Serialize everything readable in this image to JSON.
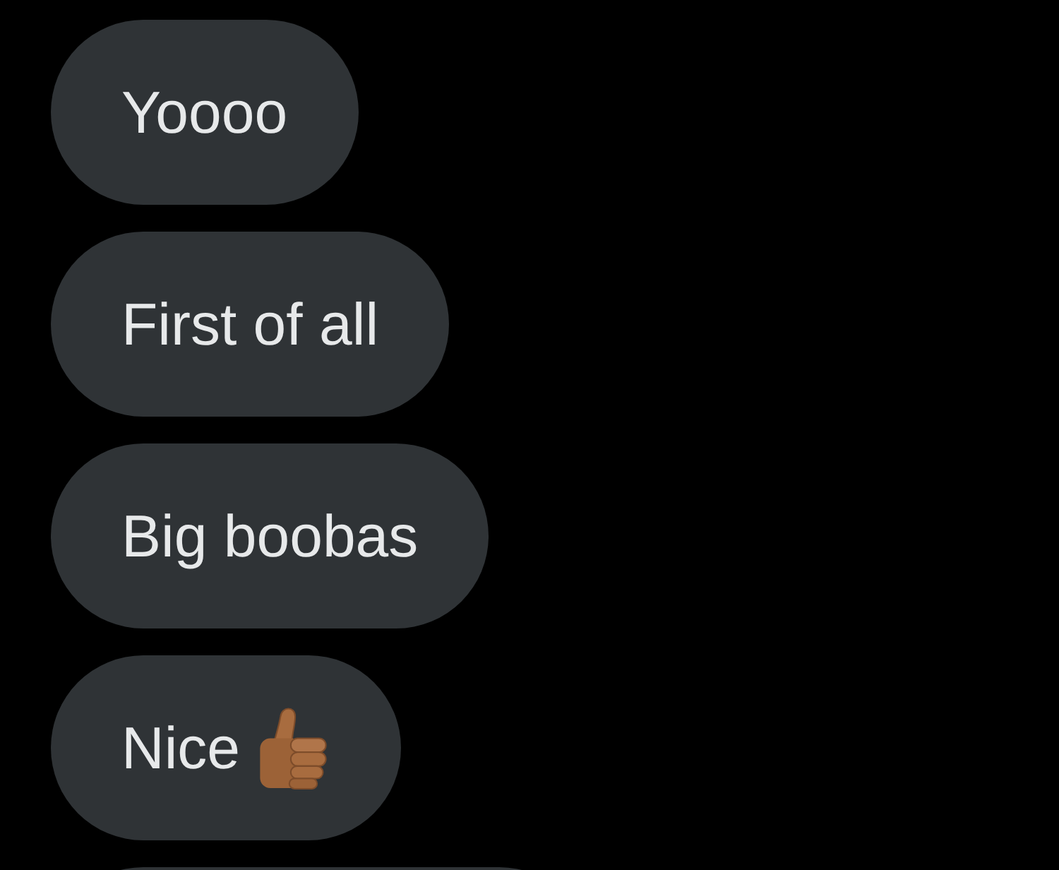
{
  "messages": [
    {
      "kind": "text",
      "text": "Yoooo"
    },
    {
      "kind": "text",
      "text": "First of all"
    },
    {
      "kind": "text",
      "text": "Big boobas"
    },
    {
      "kind": "text_icon",
      "text": "Nice"
    },
    {
      "kind": "cut_off"
    }
  ]
}
